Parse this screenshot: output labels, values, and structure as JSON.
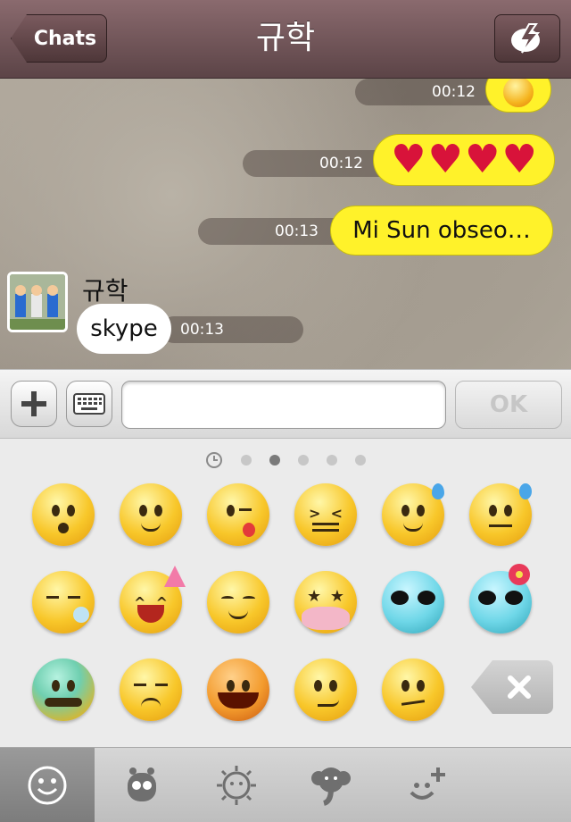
{
  "header": {
    "back_label": "Chats",
    "title": "규학",
    "flash_icon": "lightning-icon"
  },
  "messages": [
    {
      "time": "00:12",
      "type": "emoticon",
      "side": "outgoing"
    },
    {
      "time": "00:12",
      "type": "hearts",
      "side": "outgoing"
    },
    {
      "time": "00:13",
      "text": "Mi Sun obseo…",
      "side": "outgoing"
    },
    {
      "sender": "규학",
      "time": "00:13",
      "text": "skype",
      "side": "incoming"
    }
  ],
  "input": {
    "placeholder": "",
    "ok_label": "OK",
    "plus_icon": "plus-icon",
    "keyboard_icon": "keyboard-icon"
  },
  "emoji_panel": {
    "pages": 5,
    "active_page": 2,
    "emojis": [
      "surprised",
      "smile",
      "wink-tongue",
      "squint",
      "sweat-smile",
      "worried-sweat",
      "sleepy",
      "party-laugh",
      "content",
      "star-eyes",
      "alien",
      "alien-flower",
      "sick-green",
      "sad",
      "devil",
      "smirk",
      "annoyed"
    ]
  },
  "tabs": [
    "emoticon-tab",
    "character-tab",
    "sun-tab",
    "elephant-tab",
    "custom-add-tab"
  ],
  "colors": {
    "header": "#6e5458",
    "yellow_bubble": "#fff22a",
    "white_bubble": "#ffffff"
  }
}
